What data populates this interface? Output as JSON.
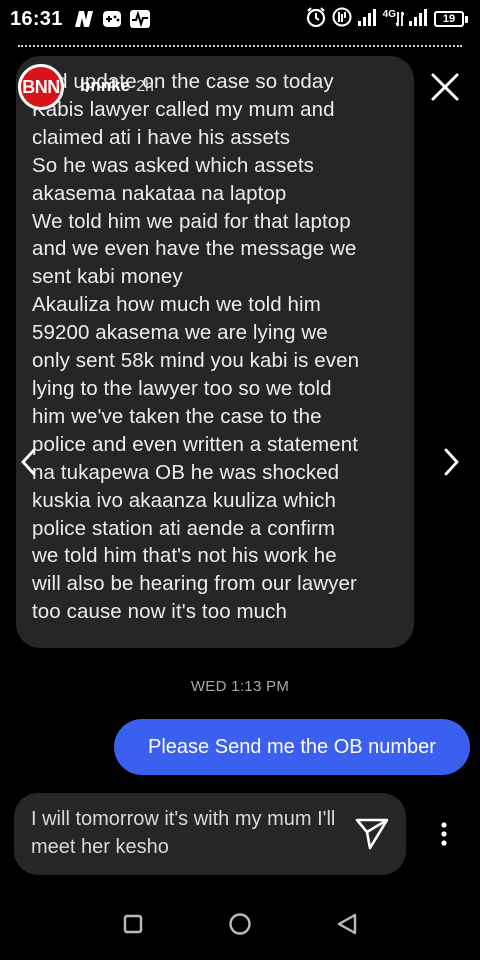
{
  "status_bar": {
    "time": "16:31",
    "left_icons": [
      "n-logo-icon",
      "gamepad-icon",
      "activity-icon"
    ],
    "right_icons": [
      "alarm-icon",
      "data-saver-icon",
      "signal-icon",
      "volte-4g-icon",
      "signal-icon"
    ],
    "network_label": "4G",
    "battery_level": "19",
    "battery_fraction": 0.19
  },
  "story": {
    "logo_text": "BNN",
    "username": "bnnke",
    "age": "2h",
    "close_icon": "close-icon"
  },
  "conversation": {
    "incoming_message_lines": [
      "Fed update on the case so today",
      "Kabis lawyer called my mum and",
      "claimed ati i have his assets",
      "So he was asked which assets",
      "akasema nakataa na laptop",
      "We told him we paid for that laptop",
      "and we even have the message we",
      "sent kabi money",
      "Akauliza how much we told him",
      "59200 akasema we are lying we",
      "only sent 58k mind you kabi is even",
      "lying to the lawyer too so we told",
      "him we've taken the case to the",
      "police and even written a statement",
      "na tukapewa OB he was shocked",
      "kuskia ivo akaanza kuuliza which",
      "police station ati aende a confirm",
      "we told him that's not his work he",
      "will also be hearing from our lawyer",
      "too cause now it's too much"
    ],
    "timestamp": "WED 1:13 PM",
    "outgoing_message": "Please Send me the OB number",
    "composer_lines": [
      "I will tomorrow it's with my mum I'll",
      "meet her kesho"
    ]
  },
  "icons": {
    "prev": "chevron-left-icon",
    "next": "chevron-right-icon",
    "send": "send-icon",
    "more": "more-vertical-icon"
  },
  "android_nav": [
    "recents-icon",
    "home-icon",
    "back-icon"
  ],
  "colors": {
    "background": "#000000",
    "incoming_bubble": "#262626",
    "outgoing_bubble": "#3b5fee",
    "brand_red": "#d6141a"
  }
}
